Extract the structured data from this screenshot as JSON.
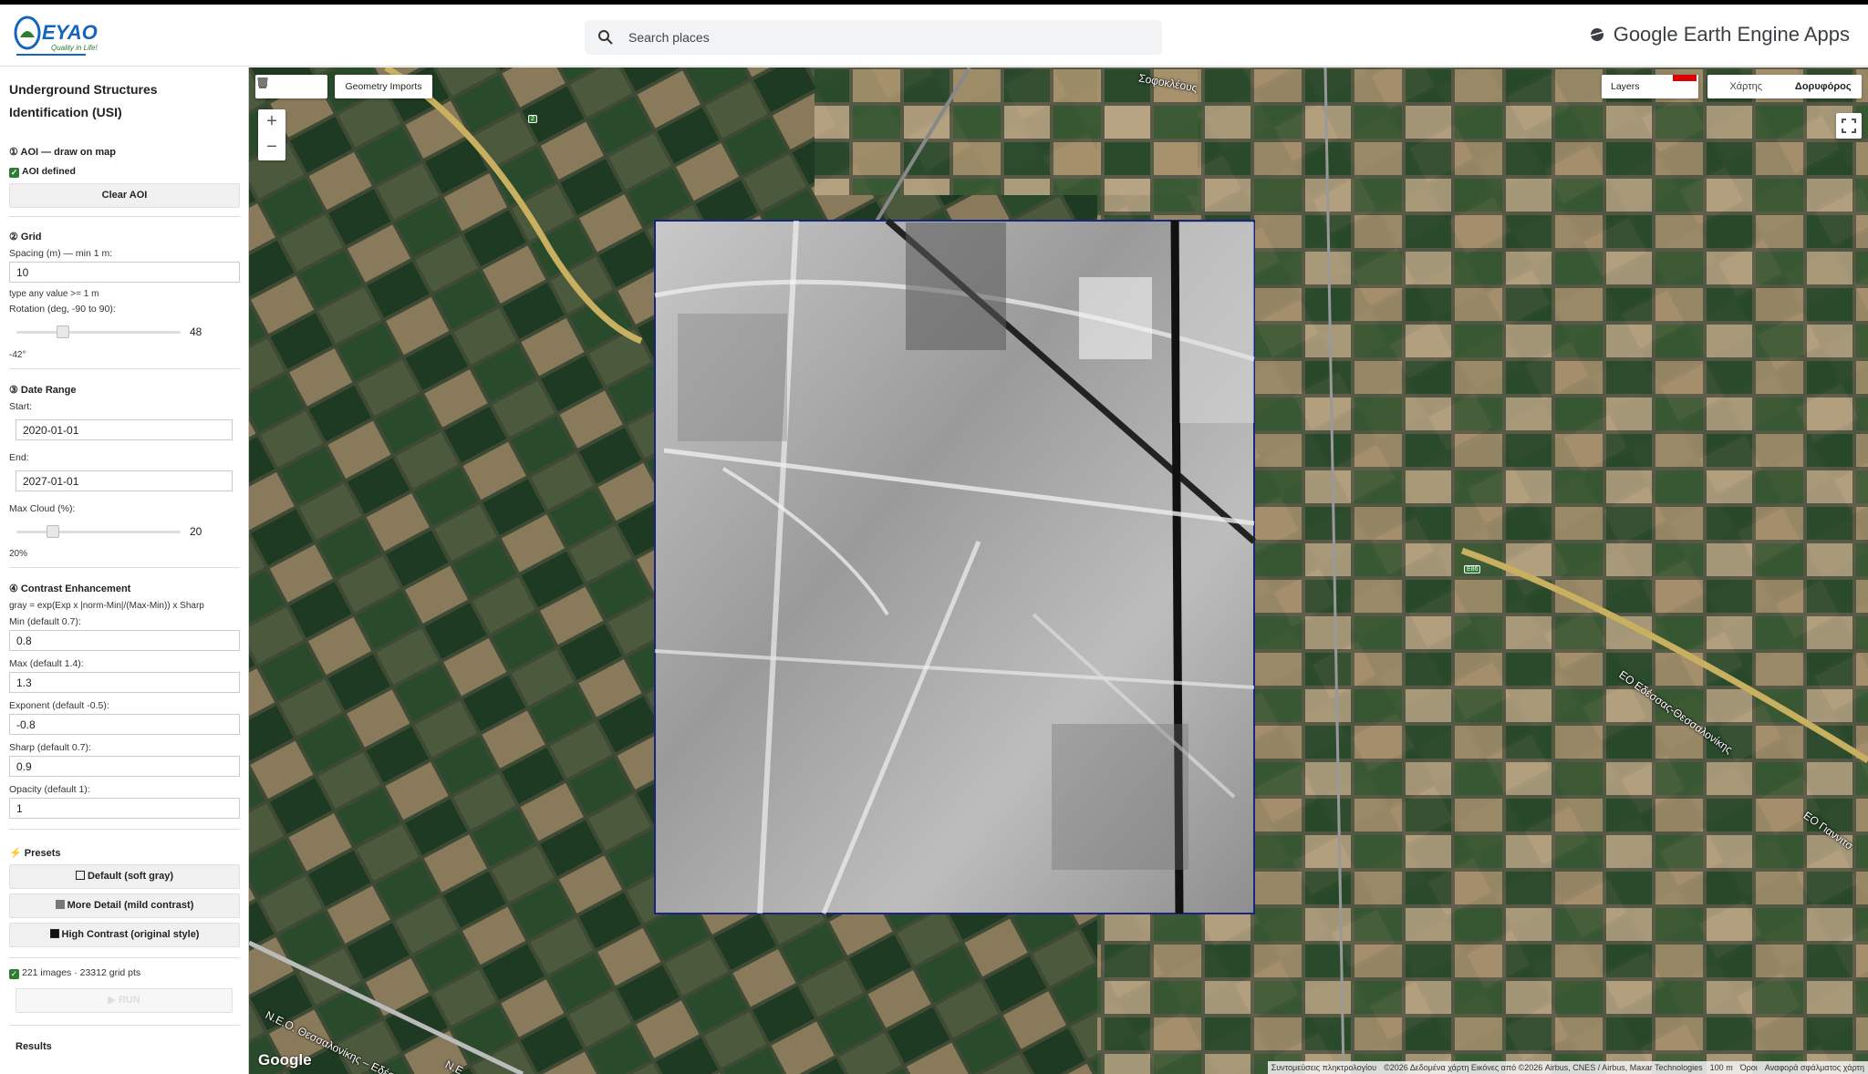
{
  "header": {
    "logo_text": "EYAO",
    "logo_tagline": "Quality in Life!",
    "search_placeholder": "Search places",
    "app_brand": "Google Earth Engine Apps"
  },
  "sidebar": {
    "title_line1": "Underground Structures",
    "title_line2": "Identification (USI)",
    "aoi": {
      "title": "① AOI — draw on map",
      "status": "AOI defined",
      "clear_label": "Clear AOI"
    },
    "grid": {
      "title": "② Grid",
      "spacing_label": "Spacing (m) — min 1 m:",
      "spacing_value": "10",
      "spacing_hint": "type any value >= 1 m",
      "rotation_label": "Rotation (deg, -90 to 90):",
      "rotation_slider_value": "48",
      "rotation_readout": "-42°"
    },
    "dates": {
      "title": "③ Date Range",
      "start_label": "Start:",
      "start_value": "2020-01-01",
      "end_label": "End:",
      "end_value": "2027-01-01",
      "cloud_label": "Max Cloud (%):",
      "cloud_slider_value": "20",
      "cloud_readout": "20%"
    },
    "contrast": {
      "title": "④ Contrast Enhancement",
      "formula": "gray = exp(Exp x |norm-Min|/(Max-Min)) x Sharp",
      "min_label": "Min (default 0.7):",
      "min_value": "0.8",
      "max_label": "Max (default 1.4):",
      "max_value": "1.3",
      "exp_label": "Exponent (default -0.5):",
      "exp_value": "-0.8",
      "sharp_label": "Sharp (default 0.7):",
      "sharp_value": "0.9",
      "opacity_label": "Opacity (default 1):",
      "opacity_value": "1"
    },
    "presets": {
      "title": "Presets",
      "default_label": "Default (soft gray)",
      "detail_label": "More Detail (mild contrast)",
      "high_label": "High Contrast (original style)"
    },
    "status_line": "221 images · 23312 grid pts",
    "run_label": "▶ RUN",
    "results_label": "Results"
  },
  "map": {
    "geometry_imports": "Geometry Imports",
    "layers_label": "Layers",
    "map_type_map": "Χάρτης",
    "map_type_satellite": "Δορυφόρος",
    "zoom_in": "+",
    "zoom_out": "−",
    "google_logo": "Google",
    "street_1": "Σοφοκλέους",
    "street_2": "ΕΟ Εδέσσας-Θεσσαλονίκης",
    "street_3": "ΕΟ Γιαννιτσ",
    "street_4": "Ν.Ε.Ο. Θεσσαλονίκης – Εδέσσας",
    "street_5": "Ν.Ε",
    "shield_1": "2",
    "shield_2": "E86",
    "attr_shortcuts": "Συντομεύσεις πληκτρολογίου",
    "attr_data": "©2026 Δεδομένα χάρτη Εικόνες από ©2026 Airbus, CNES / Airbus, Maxar Technologies",
    "attr_scale": "100 m",
    "attr_terms": "Όροι",
    "attr_report": "Αναφορά σφάλματος χάρτη"
  }
}
